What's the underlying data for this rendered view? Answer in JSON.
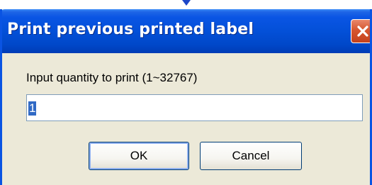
{
  "window": {
    "title": "Print previous printed label",
    "close_icon": "close-icon"
  },
  "form": {
    "prompt": "Input quantity to print  (1~32767)",
    "quantity_value": "1"
  },
  "buttons": {
    "ok_label": "OK",
    "cancel_label": "Cancel"
  },
  "colors": {
    "titlebar": "#0a55e4",
    "dialog_bg": "#ece9d8",
    "close_button": "#d6562f",
    "selection": "#316ac5"
  }
}
